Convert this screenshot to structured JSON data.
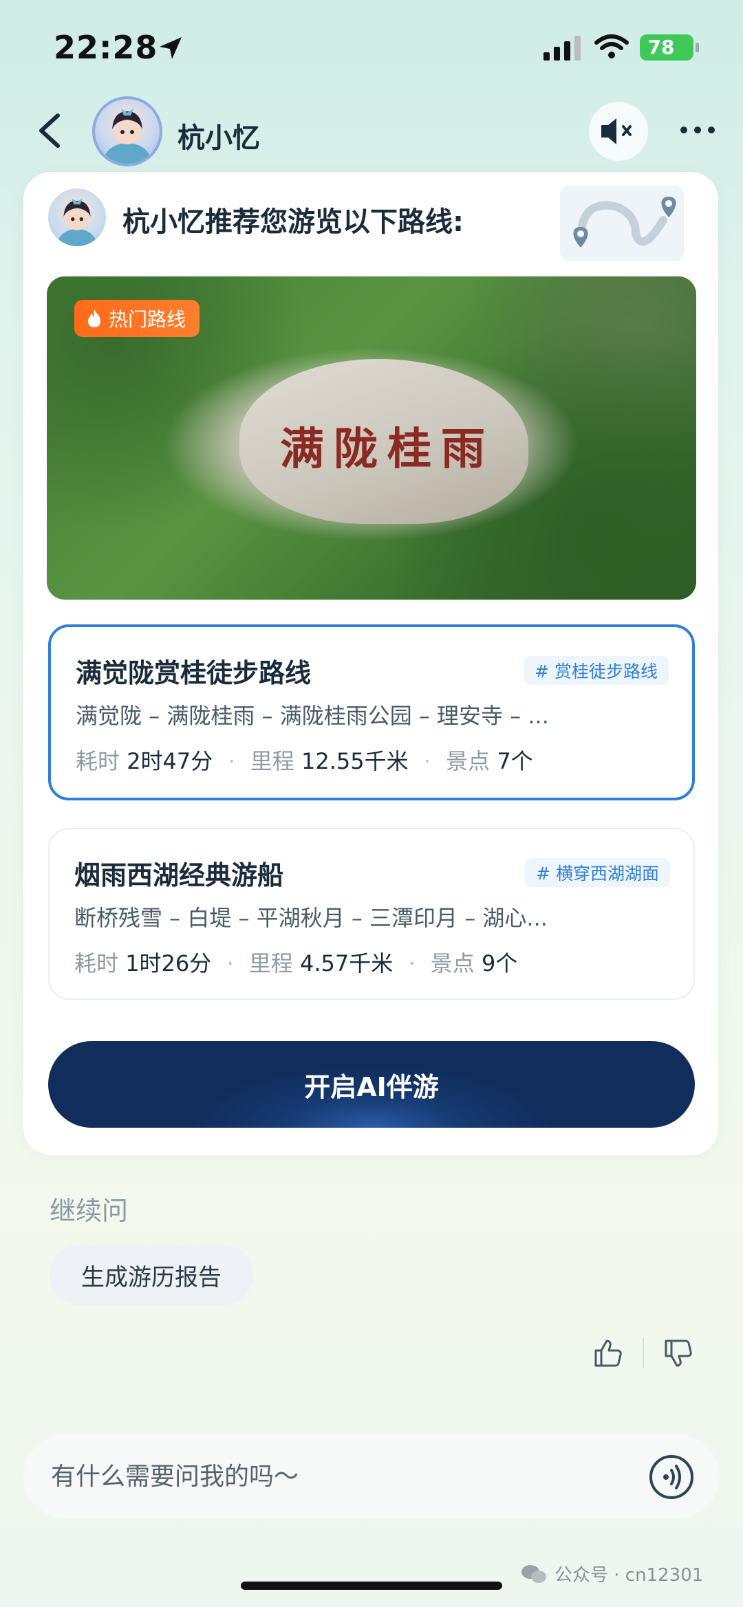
{
  "status": {
    "time": "22:28",
    "battery": "78"
  },
  "header": {
    "title": "杭小忆"
  },
  "card": {
    "title": "杭小忆推荐您游览以下路线:",
    "hero_badge": "热门路线",
    "hero_inscription": "满陇桂雨",
    "routes": [
      {
        "name": "满觉陇赏桂徒步路线",
        "tag": "# 赏桂徒步路线",
        "stops": "满觉陇 – 满陇桂雨 – 满陇桂雨公园 – 理安寺 – ...",
        "time_label": "耗时",
        "time_value": "2时47分",
        "distance_label": "里程",
        "distance_value": "12.55千米",
        "spots_label": "景点",
        "spots_value": "7个"
      },
      {
        "name": "烟雨西湖经典游船",
        "tag": "# 横穿西湖湖面",
        "stops": "断桥残雪 – 白堤 – 平湖秋月 – 三潭印月 – 湖心...",
        "time_label": "耗时",
        "time_value": "1时26分",
        "distance_label": "里程",
        "distance_value": "4.57千米",
        "spots_label": "景点",
        "spots_value": "9个"
      }
    ],
    "cta_label": "开启AI伴游"
  },
  "followup": {
    "label": "继续问",
    "chip": "生成游历报告"
  },
  "input": {
    "placeholder": "有什么需要问我的吗～"
  },
  "watermark": "公众号 · cn12301",
  "colors": {
    "accent": "#2f7fd6",
    "cta": "#163a72",
    "hot": "#ff6a1a",
    "battery": "#3ec95a"
  },
  "icons": [
    "location-arrow-icon",
    "signal-icon",
    "wifi-icon",
    "battery-icon",
    "back-icon",
    "mute-icon",
    "more-icon",
    "map-route-icon",
    "flame-icon",
    "thumbs-up-icon",
    "thumbs-down-icon",
    "voice-icon",
    "wechat-icon"
  ]
}
